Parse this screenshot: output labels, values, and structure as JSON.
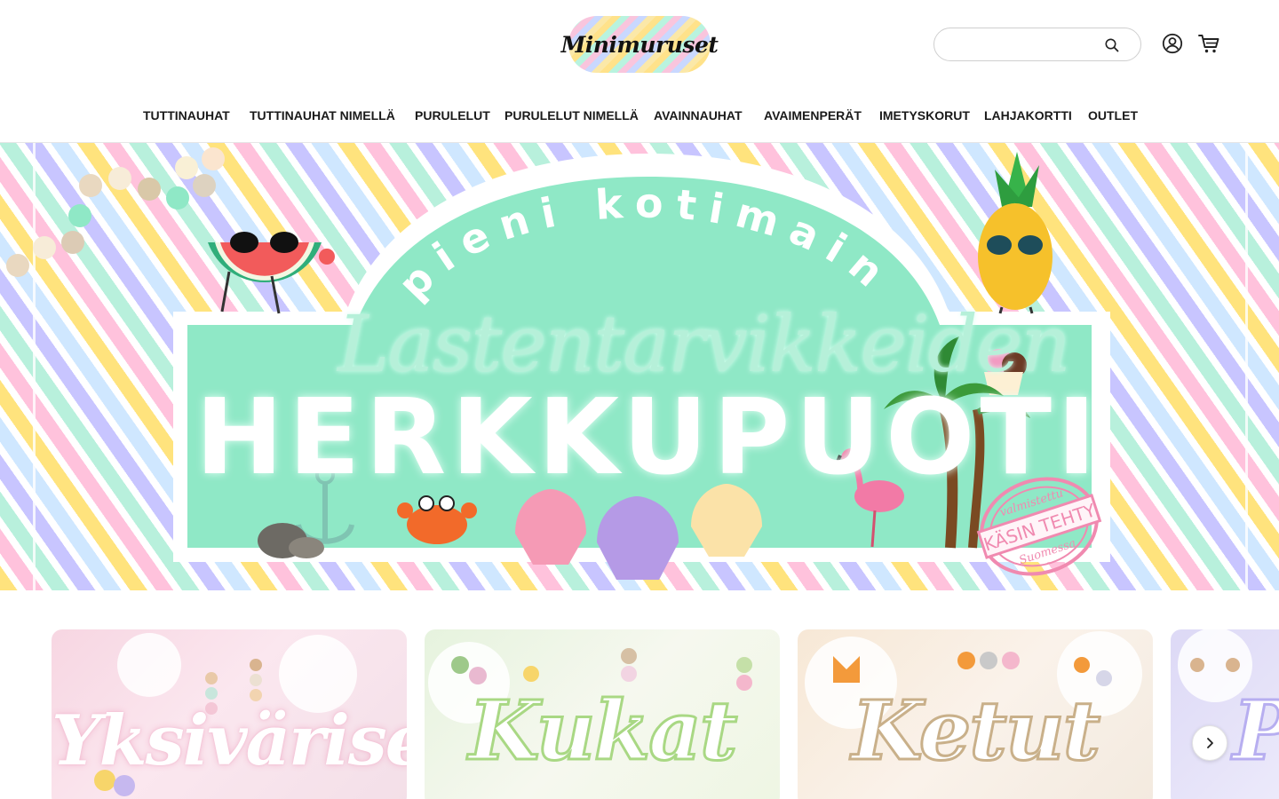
{
  "header": {
    "logo_text": "Minimuruset",
    "search": {
      "placeholder": "",
      "value": ""
    },
    "icons": {
      "search": "search-icon",
      "account": "account-icon",
      "cart": "cart-icon"
    }
  },
  "nav": {
    "items": [
      {
        "label": "TUTTINAUHAT"
      },
      {
        "label": "TUTTINAUHAT NIMELLÄ"
      },
      {
        "label": "PURULELUT"
      },
      {
        "label": "PURULELUT NIMELLÄ"
      },
      {
        "label": "AVAINNAUHAT"
      },
      {
        "label": "AVAIMENPERÄT"
      },
      {
        "label": "IMETYSKORUT"
      },
      {
        "label": "LAHJAKORTTI"
      },
      {
        "label": "OUTLET"
      }
    ]
  },
  "hero": {
    "small_text": "pieni kotimainen",
    "script_text": "Lastentarvikkeiden",
    "big_text": "HERKKUPUOTI",
    "stamp_top": "valmistettu",
    "stamp_main": "KÄSIN TEHTY",
    "stamp_bottom": "Suomessa"
  },
  "collections": {
    "cards": [
      {
        "title": "Yksiväriset"
      },
      {
        "title": "Kukat"
      },
      {
        "title": "Ketut"
      },
      {
        "title": "P"
      }
    ],
    "next_label": "›"
  },
  "colors": {
    "mint": "#8fe8c6",
    "pink": "#ffc2dc",
    "yellow": "#ffe37d",
    "lavender": "#c8c5ff",
    "text": "#1a1a1a"
  }
}
